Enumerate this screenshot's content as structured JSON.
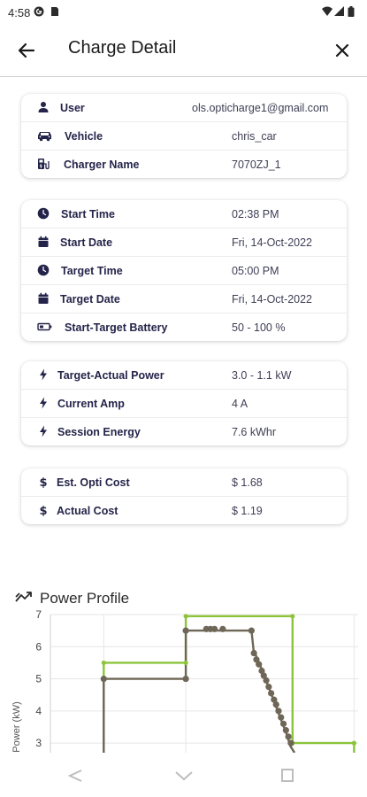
{
  "status_bar": {
    "time": "4:58",
    "icons": [
      "g-icon",
      "sim-icon",
      "wifi-icon",
      "signal-icon",
      "battery-icon"
    ]
  },
  "header": {
    "title": "Charge Detail",
    "back_icon": "arrow-left-icon",
    "close_icon": "close-icon"
  },
  "cards": {
    "user": [
      {
        "icon": "user-icon",
        "label": "User",
        "value": "ols.opticharge1@gmail.com"
      },
      {
        "icon": "car-icon",
        "label": "Vehicle",
        "value": "chris_car"
      },
      {
        "icon": "charger-icon",
        "label": "Charger Name",
        "value": "7070ZJ_1"
      }
    ],
    "schedule": [
      {
        "icon": "clock-icon",
        "label": "Start Time",
        "value": "02:38 PM"
      },
      {
        "icon": "calendar-icon",
        "label": "Start Date",
        "value": "Fri, 14-Oct-2022"
      },
      {
        "icon": "clock-icon",
        "label": "Target Time",
        "value": "05:00 PM"
      },
      {
        "icon": "calendar-icon",
        "label": "Target Date",
        "value": "Fri, 14-Oct-2022"
      },
      {
        "icon": "battery-icon",
        "label": "Start-Target Battery",
        "value": "50 - 100 %"
      }
    ],
    "power": [
      {
        "icon": "bolt-icon",
        "label": "Target-Actual Power",
        "value": "3.0 - 1.1 kW"
      },
      {
        "icon": "bolt-icon",
        "label": "Current Amp",
        "value": "4 A"
      },
      {
        "icon": "bolt-icon",
        "label": "Session Energy",
        "value": "7.6 kWhr"
      }
    ],
    "cost": [
      {
        "icon": "dollar-icon",
        "label": "Est. Opti Cost",
        "value": "$ 1.68"
      },
      {
        "icon": "dollar-icon",
        "label": "Actual Cost",
        "value": "$ 1.19"
      }
    ]
  },
  "power_profile": {
    "title": "Power Profile",
    "icon": "trend-icon"
  },
  "chart_data": {
    "type": "line",
    "ylabel": "Power (kW)",
    "ylim": [
      2.7,
      7
    ],
    "yticks": [
      3,
      4,
      5,
      6,
      7
    ],
    "xlim": [
      0,
      7.5
    ],
    "grid": true,
    "legend": "none",
    "series": [
      {
        "color": "#8cc43a",
        "step": true,
        "points": [
          [
            1.3,
            2.7
          ],
          [
            1.3,
            5.5
          ],
          [
            3.3,
            5.5
          ],
          [
            3.3,
            6.95
          ],
          [
            5.9,
            6.95
          ],
          [
            5.9,
            3.0
          ],
          [
            7.4,
            3.0
          ],
          [
            7.4,
            2.7
          ]
        ]
      },
      {
        "color": "#6e6656",
        "step": true,
        "points": [
          [
            1.3,
            2.7
          ],
          [
            1.3,
            5.0
          ],
          [
            3.3,
            5.0
          ],
          [
            3.3,
            6.5
          ],
          [
            4.9,
            6.5
          ],
          [
            4.95,
            5.9
          ],
          [
            5.15,
            5.3
          ],
          [
            5.3,
            4.8
          ],
          [
            5.45,
            4.3
          ],
          [
            5.6,
            3.8
          ],
          [
            5.75,
            3.3
          ],
          [
            5.85,
            2.9
          ],
          [
            5.95,
            2.7
          ]
        ]
      }
    ],
    "markers": [
      [
        1.3,
        5.5
      ],
      [
        3.3,
        5.5
      ],
      [
        3.3,
        6.95
      ],
      [
        5.9,
        6.95
      ],
      [
        5.9,
        3.0
      ],
      [
        7.4,
        3.0
      ],
      [
        1.3,
        5.0
      ],
      [
        3.3,
        5.0
      ],
      [
        3.3,
        6.5
      ],
      [
        3.8,
        6.55
      ],
      [
        3.9,
        6.55
      ],
      [
        4.0,
        6.55
      ],
      [
        4.2,
        6.55
      ],
      [
        4.9,
        6.5
      ],
      [
        4.96,
        5.8
      ],
      [
        5.02,
        5.6
      ],
      [
        5.08,
        5.45
      ],
      [
        5.15,
        5.25
      ],
      [
        5.2,
        5.1
      ],
      [
        5.26,
        4.95
      ],
      [
        5.32,
        4.75
      ],
      [
        5.38,
        4.55
      ],
      [
        5.45,
        4.35
      ],
      [
        5.5,
        4.2
      ],
      [
        5.56,
        4.0
      ],
      [
        5.62,
        3.8
      ],
      [
        5.68,
        3.6
      ],
      [
        5.74,
        3.4
      ],
      [
        5.8,
        3.2
      ],
      [
        5.86,
        3.0
      ]
    ]
  },
  "nav_bar": {
    "back": "nav-back-icon",
    "home": "nav-home-icon",
    "recents": "nav-recents-icon"
  }
}
